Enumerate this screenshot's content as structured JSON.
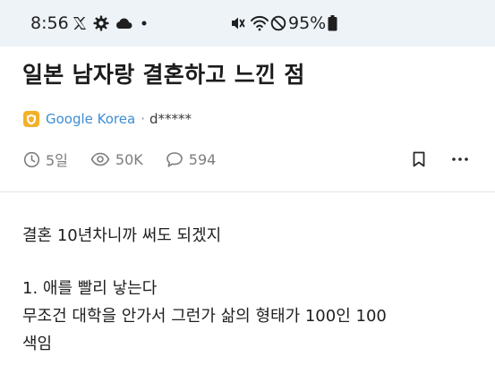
{
  "status_bar": {
    "time": "8:56",
    "battery_percent": "95%"
  },
  "post": {
    "title": "일본 남자랑 결혼하고 느낀 점",
    "company": "Google Korea",
    "separator": "·",
    "author": "d*****",
    "stats": {
      "time_ago": "5일",
      "views": "50K",
      "comments": "594"
    },
    "body": [
      "결혼 10년차니까 써도 되겠지",
      "1. 애를 빨리 낳는다",
      "무조건 대학을 안가서 그런가 삶의 형태가 100인 100",
      "색임"
    ]
  },
  "colors": {
    "status_bar_bg": "#eef3f8",
    "company_link": "#3d8dd4",
    "company_badge": "#f3b02a",
    "meta_gray": "#7d7d7d"
  },
  "icons": {
    "status_bar": [
      "x-logo-icon",
      "settings-gear-icon",
      "cloud-icon",
      "dot-icon",
      "mute-vibrate-icon",
      "wifi-call-icon",
      "do-not-disturb-icon",
      "battery-icon"
    ],
    "meta": [
      "company-shield-icon",
      "clock-icon",
      "eye-icon",
      "comment-icon",
      "bookmark-icon",
      "more-horizontal-icon"
    ]
  }
}
